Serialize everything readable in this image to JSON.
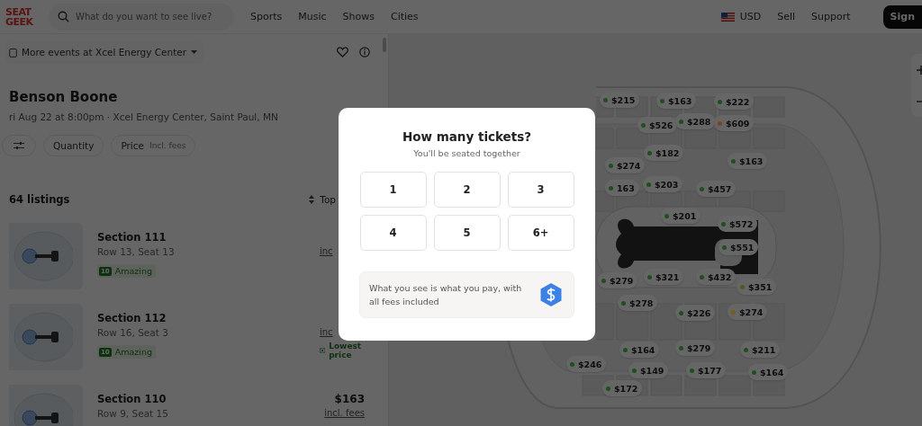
{
  "header": {
    "logo_lines": [
      "SEAT",
      "GEEK"
    ],
    "search": {
      "placeholder": "What do you want to see live?"
    },
    "nav": [
      "Sports",
      "Music",
      "Shows",
      "Cities"
    ],
    "currency": "USD",
    "links": [
      "Sell",
      "Support"
    ],
    "sign_in": "Sign"
  },
  "event": {
    "venue_menu": "More events at Xcel Energy Center",
    "title": "Benson Boone",
    "subtitle": "ri Aug 22 at 8:00pm · Xcel Energy Center, Saint Paul, MN",
    "filters": [
      {
        "kind": "icon"
      },
      {
        "kind": "text",
        "label": "Quantity"
      },
      {
        "kind": "text",
        "label": "Price",
        "note": "Incl. fees"
      }
    ]
  },
  "listings": {
    "count": "64 listings",
    "sort": "Top",
    "items": [
      {
        "section": "Section 111",
        "seats": "Row 13, Seat 13",
        "fees": "inc",
        "score": "10",
        "rating": "Amazing"
      },
      {
        "section": "Section 112",
        "seats": "Row 16, Seat 3",
        "fees": "inc",
        "score": "10",
        "rating": "Amazing",
        "tag": "Lowest price"
      },
      {
        "section": "Section 110",
        "seats": "Row 9, Seat 15",
        "price": "$163",
        "fees": "incl. fees"
      }
    ]
  },
  "map": {
    "pins": [
      {
        "price": "$215",
        "color": "#1f4f1f"
      },
      {
        "price": "$163",
        "color": "#1f4f1f"
      },
      {
        "price": "$222",
        "color": "#1f4f1f"
      },
      {
        "price": "$526",
        "color": "#1f4f1f"
      },
      {
        "price": "$288",
        "color": "#1f4f1f"
      },
      {
        "price": "$609",
        "color": "#7a4420"
      },
      {
        "price": "$182",
        "color": "#1f4f1f"
      },
      {
        "price": "$274",
        "color": "#1f4f1f"
      },
      {
        "price": "163",
        "color": "#1f4f1f"
      },
      {
        "price": "$163",
        "color": "#1f4f1f"
      },
      {
        "price": "$203",
        "color": "#1f4f1f"
      },
      {
        "price": "$457",
        "color": "#1f4f1f"
      },
      {
        "price": "$201",
        "color": "#1f4f1f"
      },
      {
        "price": "$572",
        "color": "#1f4f1f"
      },
      {
        "price": "$551",
        "color": "#1f4f1f"
      },
      {
        "price": "$279",
        "color": "#1f4f1f"
      },
      {
        "price": "$321",
        "color": "#1f4f1f"
      },
      {
        "price": "$432",
        "color": "#1f4f1f"
      },
      {
        "price": "$351",
        "color": "#4d5a20"
      },
      {
        "price": "$278",
        "color": "#1f4f1f"
      },
      {
        "price": "$226",
        "color": "#1f4f1f"
      },
      {
        "price": "$274",
        "color": "#7a5c14"
      },
      {
        "price": "$164",
        "color": "#1f4f1f"
      },
      {
        "price": "$279",
        "color": "#1f4f1f"
      },
      {
        "price": "$211",
        "color": "#1f4f1f"
      },
      {
        "price": "$246",
        "color": "#1f4f1f"
      },
      {
        "price": "$149",
        "color": "#1f4f1f"
      },
      {
        "price": "$177",
        "color": "#1f4f1f"
      },
      {
        "price": "$164",
        "color": "#1f4f1f"
      },
      {
        "price": "$172",
        "color": "#1f4f1f"
      }
    ]
  },
  "modal": {
    "title": "How many tickets?",
    "subtitle": "You'll be seated together",
    "options": [
      {
        "label": "1",
        "selected": false
      },
      {
        "label": "2",
        "selected": false
      },
      {
        "label": "3",
        "selected": false
      },
      {
        "label": "4",
        "selected": false
      },
      {
        "label": "5",
        "selected": false
      },
      {
        "label": "6+",
        "selected": false
      }
    ],
    "info": "What you see is what you pay, with all fees included"
  }
}
